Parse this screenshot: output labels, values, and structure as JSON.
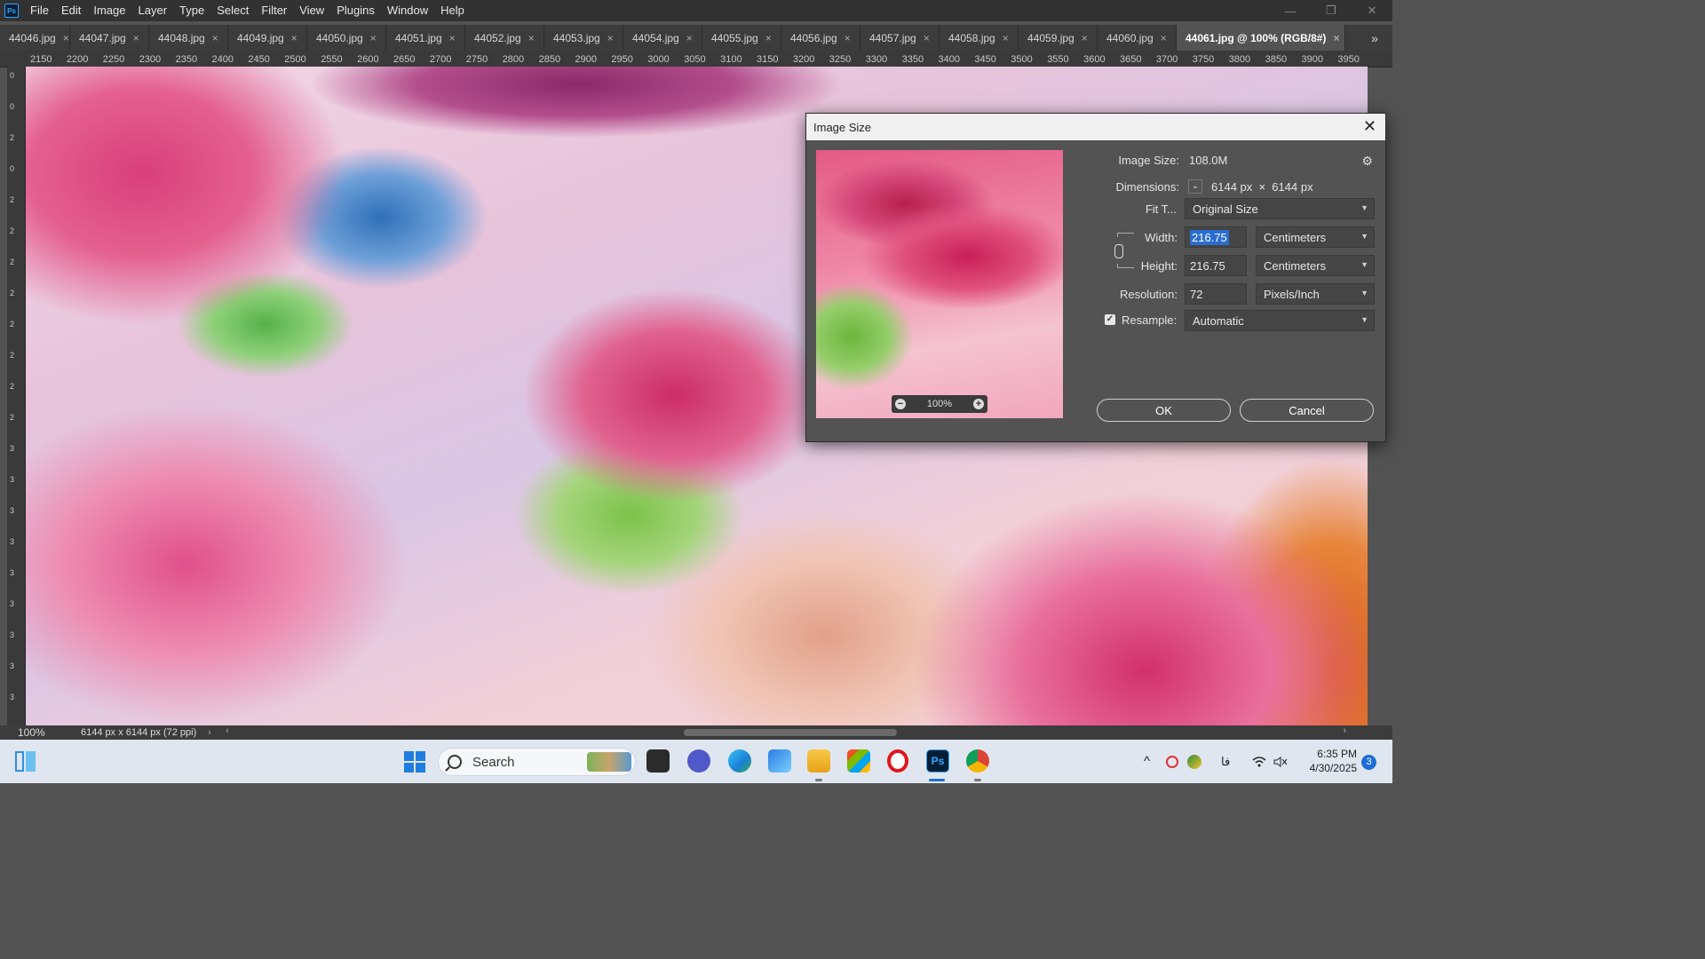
{
  "menubar": {
    "logo": "Ps",
    "items": [
      "File",
      "Edit",
      "Image",
      "Layer",
      "Type",
      "Select",
      "Filter",
      "View",
      "Plugins",
      "Window",
      "Help"
    ],
    "window_controls": {
      "minimize": "—",
      "maximize": "❐",
      "close": "✕"
    }
  },
  "tabs": {
    "items": [
      {
        "label": "44046.jpg"
      },
      {
        "label": "44047.jpg"
      },
      {
        "label": "44048.jpg"
      },
      {
        "label": "44049.jpg"
      },
      {
        "label": "44050.jpg"
      },
      {
        "label": "44051.jpg"
      },
      {
        "label": "44052.jpg"
      },
      {
        "label": "44053.jpg"
      },
      {
        "label": "44054.jpg"
      },
      {
        "label": "44055.jpg"
      },
      {
        "label": "44056.jpg"
      },
      {
        "label": "44057.jpg"
      },
      {
        "label": "44058.jpg"
      },
      {
        "label": "44059.jpg"
      },
      {
        "label": "44060.jpg"
      }
    ],
    "active": "44061.jpg @ 100% (RGB/8#)",
    "close_glyph": "×",
    "overflow": "»"
  },
  "ruler": {
    "ticks": [
      "2150",
      "2200",
      "2250",
      "2300",
      "2350",
      "2400",
      "2450",
      "2500",
      "2550",
      "2600",
      "2650",
      "2700",
      "2750",
      "2800",
      "2850",
      "2900",
      "2950",
      "3000",
      "3050",
      "3100",
      "3150",
      "3200",
      "3250",
      "3300",
      "3350",
      "3400",
      "3450",
      "3500",
      "3550",
      "3600",
      "3650",
      "3700",
      "3750",
      "3800",
      "3850",
      "3900",
      "3950"
    ],
    "vertical": [
      "0",
      "0",
      "2",
      "0",
      "2",
      "2",
      "2",
      "2",
      "2",
      "2",
      "2",
      "2",
      "3",
      "3",
      "3",
      "3",
      "3",
      "3",
      "3",
      "3",
      "3"
    ]
  },
  "status": {
    "zoom": "100%",
    "doc_info": "6144 px x 6144 px (72 ppi)",
    "arrow": "›",
    "scroll_left": "‹",
    "scroll_right": "›"
  },
  "dialog": {
    "title": "Image Size",
    "close": "✕",
    "gear": "⚙",
    "image_size_label": "Image Size:",
    "image_size_value": "108.0M",
    "dimensions_label": "Dimensions:",
    "dimensions_value": "6144 px  ×  6144 px",
    "fit_label": "Fit T...",
    "fit_value": "Original Size",
    "width_label": "Width:",
    "width_value": "216.75",
    "width_unit": "Centimeters",
    "height_label": "Height:",
    "height_value": "216.75",
    "height_unit": "Centimeters",
    "resolution_label": "Resolution:",
    "resolution_value": "72",
    "resolution_unit": "Pixels/Inch",
    "resample_label": "Resample:",
    "resample_checked": true,
    "resample_value": "Automatic",
    "preview_zoom": "100%",
    "ok": "OK",
    "cancel": "Cancel"
  },
  "taskbar": {
    "search_label": "Search",
    "apps": [
      "Task View",
      "Microsoft Teams",
      "Microsoft Edge",
      "Snipping Tool",
      "File Explorer",
      "Microsoft Store",
      "Opera",
      "Photoshop",
      "Chrome"
    ],
    "ps_label": "Ps",
    "tray": {
      "chevron": "^",
      "lang": "فا",
      "sound": "🔇"
    },
    "time": "6:35 PM",
    "date": "4/30/2025",
    "notifications": "3"
  }
}
